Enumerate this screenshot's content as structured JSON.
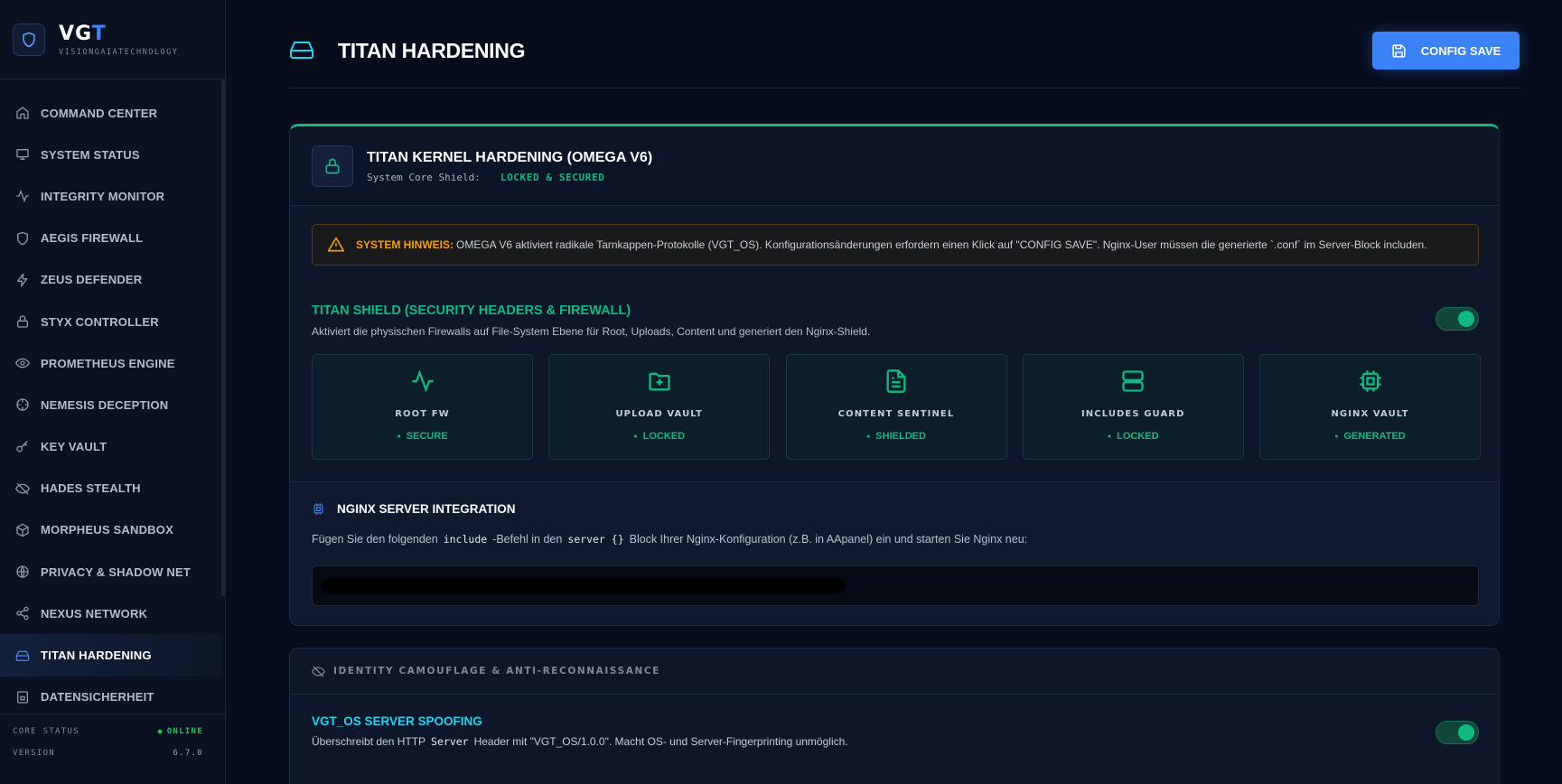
{
  "brand": {
    "title_a": "VG",
    "title_b": "T",
    "subtitle": "VISIONGAIATECHNOLOGY"
  },
  "nav": [
    {
      "label": "COMMAND CENTER",
      "icon": "home-icon"
    },
    {
      "label": "SYSTEM STATUS",
      "icon": "monitor-icon"
    },
    {
      "label": "INTEGRITY MONITOR",
      "icon": "activity-icon"
    },
    {
      "label": "AEGIS FIREWALL",
      "icon": "shield-icon"
    },
    {
      "label": "ZEUS DEFENDER",
      "icon": "bolt-icon"
    },
    {
      "label": "STYX CONTROLLER",
      "icon": "lock-icon"
    },
    {
      "label": "PROMETHEUS ENGINE",
      "icon": "eye-icon"
    },
    {
      "label": "NEMESIS DECEPTION",
      "icon": "crosshair-icon"
    },
    {
      "label": "KEY VAULT",
      "icon": "key-icon"
    },
    {
      "label": "HADES STEALTH",
      "icon": "eye-off-icon"
    },
    {
      "label": "MORPHEUS SANDBOX",
      "icon": "box-icon"
    },
    {
      "label": "PRIVACY & SHADOW NET",
      "icon": "globe-icon"
    },
    {
      "label": "NEXUS NETWORK",
      "icon": "share-icon"
    },
    {
      "label": "TITAN HARDENING",
      "icon": "hard-drive-icon",
      "active": true
    },
    {
      "label": "DATENSICHERHEIT",
      "icon": "archive-icon"
    }
  ],
  "footer": {
    "status_label": "CORE STATUS",
    "status_value": "ONLINE",
    "version_label": "VERSION",
    "version_value": "6.7.0"
  },
  "header": {
    "title": "TITAN HARDENING",
    "save_label": "CONFIG SAVE"
  },
  "kernel": {
    "title": "TITAN KERNEL HARDENING (OMEGA V6)",
    "sub_label": "System Core Shield:",
    "sub_value": "LOCKED & SECURED"
  },
  "alert": {
    "label": "SYSTEM HINWEIS:",
    "text": "OMEGA V6 aktiviert radikale Tarnkappen-Protokolle (VGT_OS). Konfigurationsänderungen erfordern einen Klick auf \"CONFIG SAVE\". Nginx-User müssen die generierte `.conf` im Server-Block includen."
  },
  "shield": {
    "title": "TITAN SHIELD (SECURITY HEADERS & FIREWALL)",
    "desc": "Aktiviert die physischen Firewalls auf File-System Ebene für Root, Uploads, Content und generiert den Nginx-Shield.",
    "enabled": true,
    "tiles": [
      {
        "name": "ROOT FW",
        "status": "SECURE",
        "icon": "activity-icon"
      },
      {
        "name": "UPLOAD VAULT",
        "status": "LOCKED",
        "icon": "folder-plus-icon"
      },
      {
        "name": "CONTENT SENTINEL",
        "status": "SHIELDED",
        "icon": "file-text-icon"
      },
      {
        "name": "INCLUDES GUARD",
        "status": "LOCKED",
        "icon": "server-icon"
      },
      {
        "name": "NGINX VAULT",
        "status": "GENERATED",
        "icon": "cpu-icon"
      }
    ]
  },
  "nginx": {
    "title": "NGINX SERVER INTEGRATION",
    "desc_a": "Fügen Sie den folgenden",
    "code_a": "include",
    "desc_b": "-Befehl in den",
    "code_b": "server {}",
    "desc_c": "Block Ihrer Nginx-Konfiguration (z.B. in AApanel) ein und starten Sie Nginx neu:"
  },
  "camouflage": {
    "title": "IDENTITY CAMOUFLAGE & ANTI-RECONNAISSANCE",
    "spoof_title": "VGT_OS SERVER SPOOFING",
    "spoof_desc_a": "Überschreibt den HTTP",
    "spoof_code": "Server",
    "spoof_desc_b": "Header mit \"VGT_OS/1.0.0\". Macht OS- und Server-Fingerprinting unmöglich.",
    "enabled": true
  },
  "colors": {
    "accent": "#3b82f6",
    "success": "#10b981",
    "warning": "#f59e0b",
    "cyan": "#22d3ee",
    "bg": "#070d1c"
  }
}
